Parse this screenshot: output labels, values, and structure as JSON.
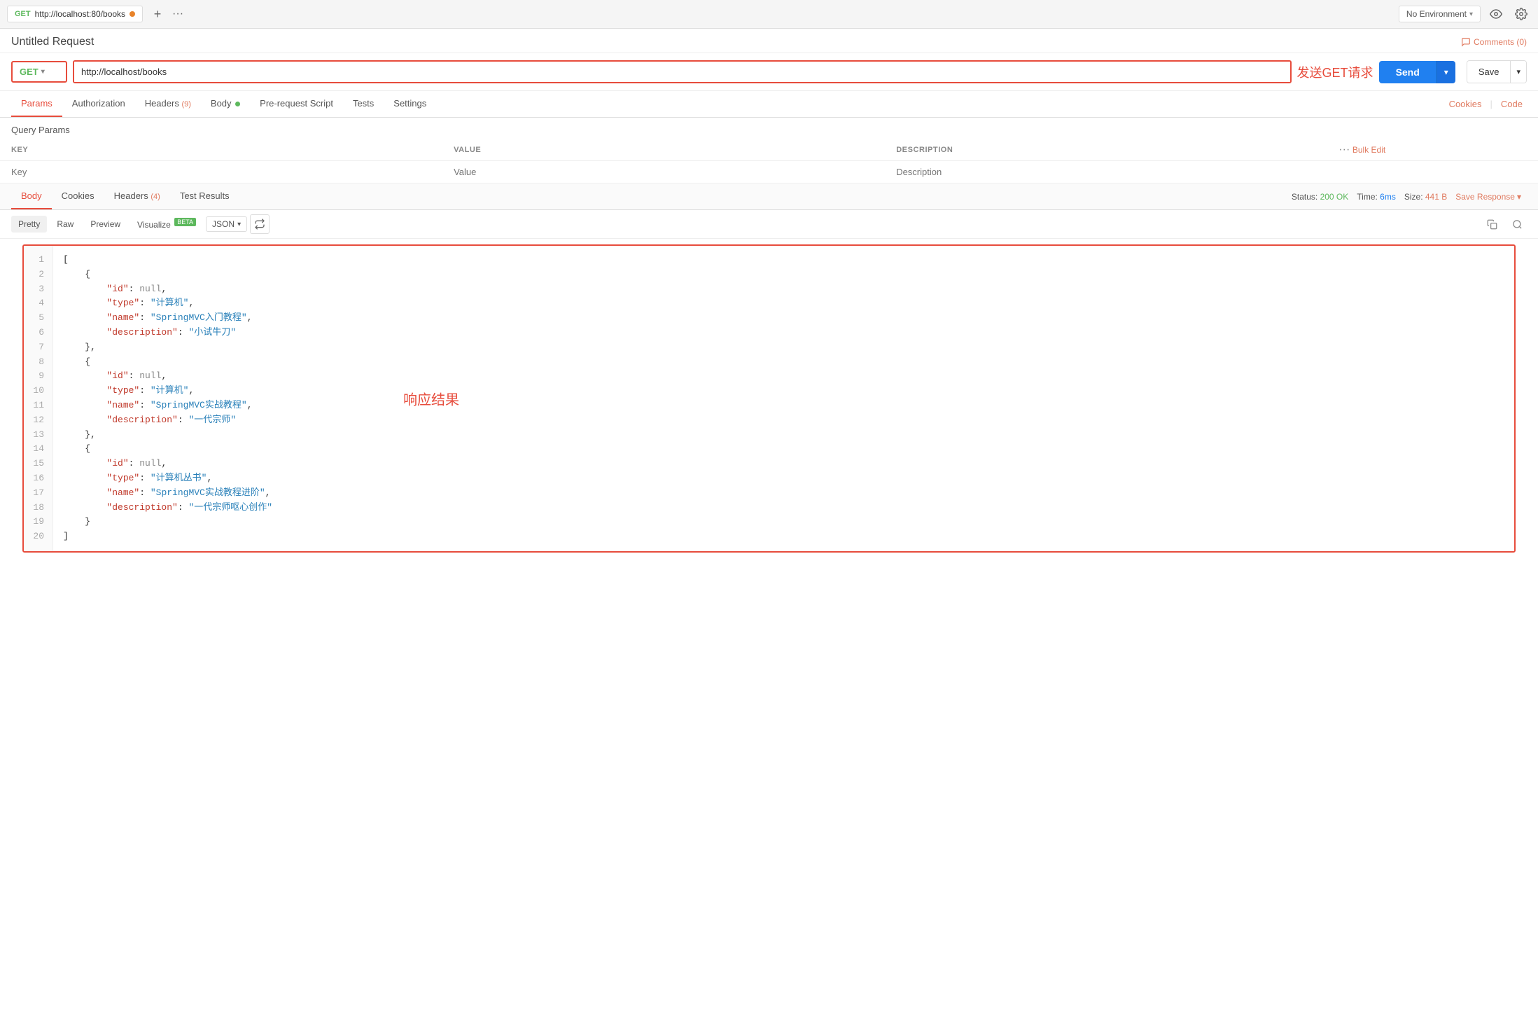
{
  "browser_tab": {
    "method": "GET",
    "url": "http://localhost:80/books",
    "plus_icon": "+",
    "more_icon": "···"
  },
  "env_selector": {
    "label": "No Environment",
    "chevron": "▾"
  },
  "title_bar": {
    "title": "Untitled Request",
    "comments": "Comments (0)"
  },
  "url_bar": {
    "method": "GET",
    "url": "http://localhost/books",
    "annotation": "发送GET请求",
    "send_label": "Send",
    "save_label": "Save"
  },
  "request_tabs": [
    {
      "id": "params",
      "label": "Params",
      "active": true
    },
    {
      "id": "auth",
      "label": "Authorization"
    },
    {
      "id": "headers",
      "label": "Headers",
      "badge": "(9)"
    },
    {
      "id": "body",
      "label": "Body",
      "has_dot": true
    },
    {
      "id": "pre-script",
      "label": "Pre-request Script"
    },
    {
      "id": "tests",
      "label": "Tests"
    },
    {
      "id": "settings",
      "label": "Settings"
    }
  ],
  "cookies_link": "Cookies",
  "code_link": "Code",
  "query_params": {
    "section_label": "Query Params",
    "columns": [
      "KEY",
      "VALUE",
      "DESCRIPTION"
    ],
    "placeholder_row": {
      "key": "Key",
      "value": "Value",
      "description": "Description"
    }
  },
  "response_tabs": [
    {
      "id": "body",
      "label": "Body",
      "active": true
    },
    {
      "id": "cookies",
      "label": "Cookies"
    },
    {
      "id": "headers",
      "label": "Headers",
      "badge": "(4)"
    },
    {
      "id": "test-results",
      "label": "Test Results"
    }
  ],
  "response_status": {
    "status_label": "Status:",
    "status_val": "200 OK",
    "time_label": "Time:",
    "time_val": "6ms",
    "size_label": "Size:",
    "size_val": "441 B",
    "save_response": "Save Response"
  },
  "format_tabs": [
    "Pretty",
    "Raw",
    "Preview",
    "Visualize"
  ],
  "visualize_beta": "BETA",
  "json_format": "JSON",
  "code_lines": [
    {
      "num": 1,
      "text": "["
    },
    {
      "num": 2,
      "text": "    {"
    },
    {
      "num": 3,
      "text": "        \"id\": null,"
    },
    {
      "num": 4,
      "text": "        \"type\": \"计算机\","
    },
    {
      "num": 5,
      "text": "        \"name\": \"SpringMVC入门教程\","
    },
    {
      "num": 6,
      "text": "        \"description\": \"小试牛刀\""
    },
    {
      "num": 7,
      "text": "    },"
    },
    {
      "num": 8,
      "text": "    {"
    },
    {
      "num": 9,
      "text": "        \"id\": null,"
    },
    {
      "num": 10,
      "text": "        \"type\": \"计算机\","
    },
    {
      "num": 11,
      "text": "        \"name\": \"SpringMVC实战教程\","
    },
    {
      "num": 12,
      "text": "        \"description\": \"一代宗师\""
    },
    {
      "num": 13,
      "text": "    },"
    },
    {
      "num": 14,
      "text": "    {"
    },
    {
      "num": 15,
      "text": "        \"id\": null,"
    },
    {
      "num": 16,
      "text": "        \"type\": \"计算机丛书\","
    },
    {
      "num": 17,
      "text": "        \"name\": \"SpringMVC实战教程进阶\","
    },
    {
      "num": 18,
      "text": "        \"description\": \"一代宗师呕心创作\""
    },
    {
      "num": 19,
      "text": "    }"
    },
    {
      "num": 20,
      "text": "]"
    }
  ],
  "response_annotation": "响应结果"
}
